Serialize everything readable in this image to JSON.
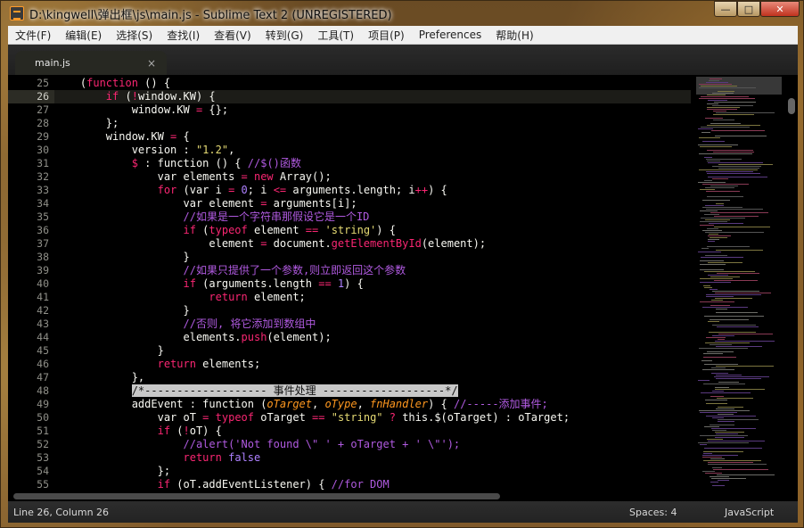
{
  "window": {
    "title": "D:\\kingwell\\弹出框\\js\\main.js - Sublime Text 2 (UNREGISTERED)",
    "controls": {
      "minimize": "—",
      "maximize": "□",
      "close": "✕"
    }
  },
  "menu": [
    "文件(F)",
    "编辑(E)",
    "选择(S)",
    "查找(I)",
    "查看(V)",
    "转到(G)",
    "工具(T)",
    "项目(P)",
    "Preferences",
    "帮助(H)"
  ],
  "tab": {
    "label": "main.js",
    "close": "×"
  },
  "editor": {
    "current_line": 26,
    "line_numbers": [
      "25",
      "26",
      "27",
      "28",
      "29",
      "30",
      "31",
      "32",
      "33",
      "34",
      "35",
      "36",
      "37",
      "38",
      "39",
      "40",
      "41",
      "42",
      "43",
      "44",
      "45",
      "46",
      "47",
      "48",
      "49",
      "50",
      "51",
      "52",
      "53",
      "54",
      "55"
    ]
  },
  "colors": {
    "keyword": "#f92672",
    "string": "#e6db74",
    "number": "#ae81ff",
    "comment": "#b05ae0",
    "function_call": "#a6e22e",
    "parameter": "#fd971f",
    "background": "#000000"
  },
  "status": {
    "position": "Line 26, Column 26",
    "spaces": "Spaces: 4",
    "syntax": "JavaScript"
  }
}
